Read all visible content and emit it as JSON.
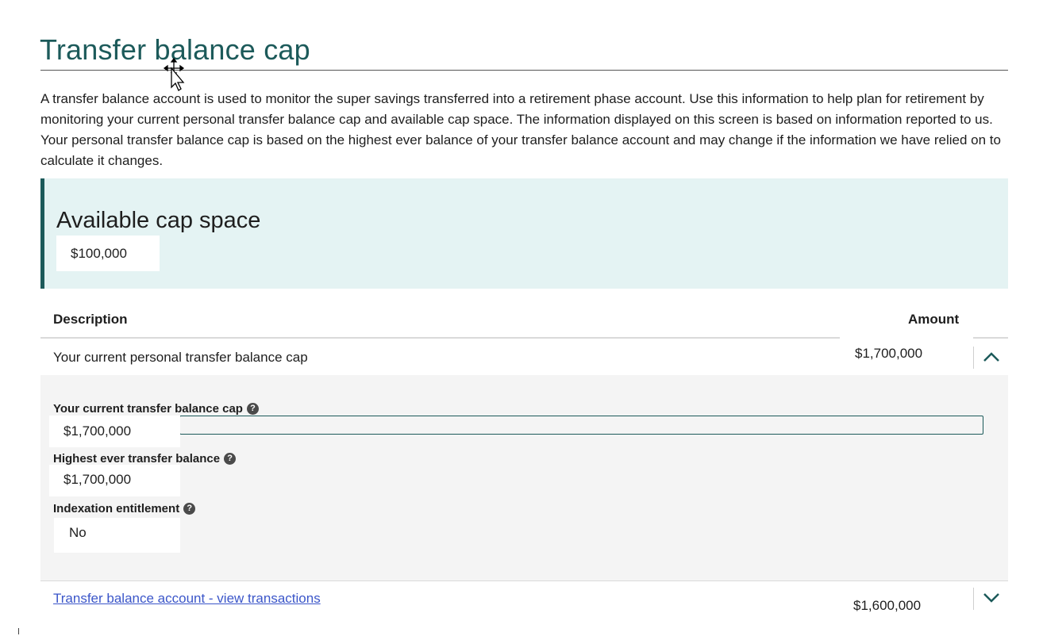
{
  "page": {
    "title": "Transfer balance cap",
    "intro": "A transfer balance account is used to monitor the super savings transferred into a retirement phase account. Use this information to help plan for retirement by monitoring your current personal transfer balance cap and available cap space. The information displayed on this screen is based on information reported to us. Your personal transfer balance cap is based on the highest ever balance of your transfer balance account and may change if the information we have relied on to calculate it changes."
  },
  "cap_space": {
    "heading": "Available cap space",
    "value": "$100,000"
  },
  "table": {
    "headers": {
      "description": "Description",
      "amount": "Amount"
    },
    "rows": [
      {
        "description": "Your current personal transfer balance cap",
        "amount": "$1,700,000",
        "expanded": true,
        "toggle_icon": "chevron-up-icon",
        "details": [
          {
            "label": "Your current transfer balance cap",
            "value": "$1,700,000",
            "icon": "help-icon"
          },
          {
            "label": "Highest ever transfer balance",
            "value": "$1,700,000",
            "icon": "help-icon"
          },
          {
            "label": "Indexation entitlement",
            "value": "No",
            "icon": "help-icon"
          }
        ]
      },
      {
        "description": "Transfer balance account - view transactions",
        "amount": "$1,600,000",
        "expanded": false,
        "toggle_icon": "chevron-down-icon"
      }
    ]
  },
  "colors": {
    "brand": "#1c5a5a",
    "panel_bg": "#e4f3f3",
    "details_bg": "#f4f4f4",
    "link": "#3b56c9"
  }
}
